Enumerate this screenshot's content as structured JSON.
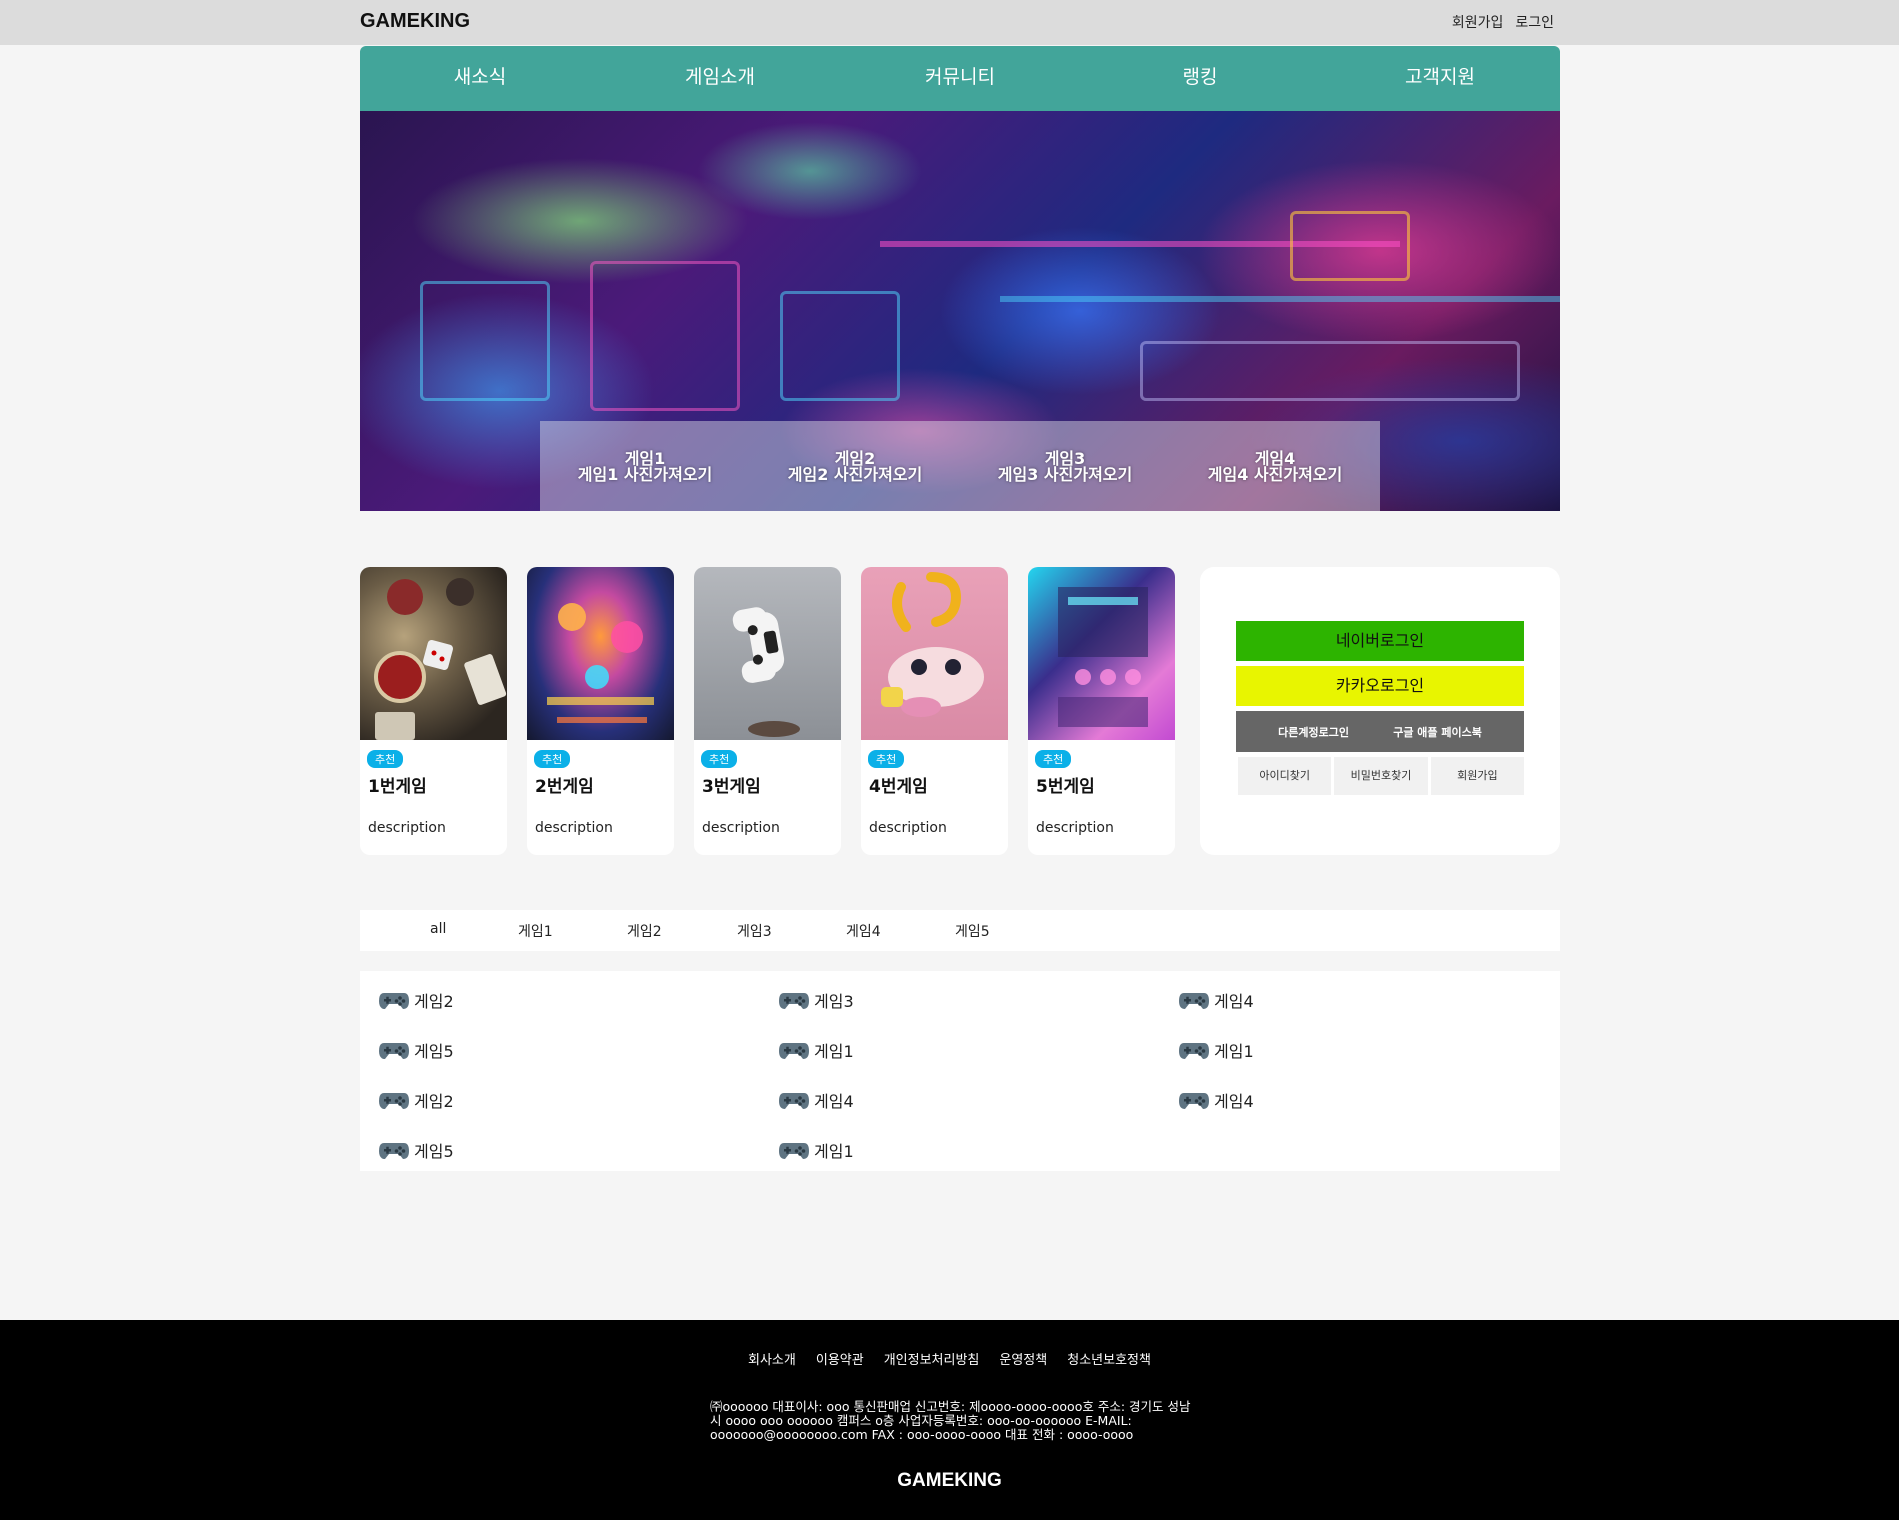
{
  "header": {
    "logo": "GAMEKING",
    "signup": "회원가입",
    "login": "로그인"
  },
  "nav": [
    "새소식",
    "게임소개",
    "커뮤니티",
    "랭킹",
    "고객지원"
  ],
  "hero": {
    "captions": [
      {
        "name": "게임1",
        "sub": "게임1 사진가져오기"
      },
      {
        "name": "게임2",
        "sub": "게임2 사진가져오기"
      },
      {
        "name": "게임3",
        "sub": "게임3 사진가져오기"
      },
      {
        "name": "게임4",
        "sub": "게임4 사진가져오기"
      }
    ]
  },
  "cards": [
    {
      "badge": "추천",
      "title": "1번게임",
      "desc": "description"
    },
    {
      "badge": "추천",
      "title": "2번게임",
      "desc": "description"
    },
    {
      "badge": "추천",
      "title": "3번게임",
      "desc": "description"
    },
    {
      "badge": "추천",
      "title": "4번게임",
      "desc": "description"
    },
    {
      "badge": "추천",
      "title": "5번게임",
      "desc": "description"
    }
  ],
  "login_box": {
    "naver": "네이버로그인",
    "kakao": "카카오로그인",
    "other": "다른계정로그인",
    "social": "구글 애플 페이스북",
    "find_id": "아이디찾기",
    "find_pw": "비밀번호찾기",
    "signup": "회원가입"
  },
  "filter_tabs": [
    "all",
    "게임1",
    "게임2",
    "게임3",
    "게임4",
    "게임5"
  ],
  "game_list": [
    "게임2",
    "게임3",
    "게임4",
    "게임5",
    "게임1",
    "게임1",
    "게임2",
    "게임4",
    "게임4",
    "게임5",
    "게임1"
  ],
  "footer": {
    "links": [
      "회사소개",
      "이용약관",
      "개인정보처리방침",
      "운영정책",
      "청소년보호정책"
    ],
    "info": "㈜oooooo 대표이사: ooo 통신판매업 신고번호: 제oooo-oooo-oooo호 주소: 경기도 성남시 oooo ooo oooooo 캠퍼스 o층 사업자등록번호: ooo-oo-oooooo E-MAIL: ooooooo@oooooooo.com FAX : ooo-oooo-oooo 대표 전화 : oooo-oooo",
    "logo": "GAMEKING"
  },
  "colors": {
    "nav_bg": "#42a59a",
    "badge": "#0bb0e8",
    "naver": "#2db400",
    "kakao": "#e8f500",
    "footer_bg": "#000000"
  },
  "icons": {
    "game_item": "gamepad-icon"
  }
}
